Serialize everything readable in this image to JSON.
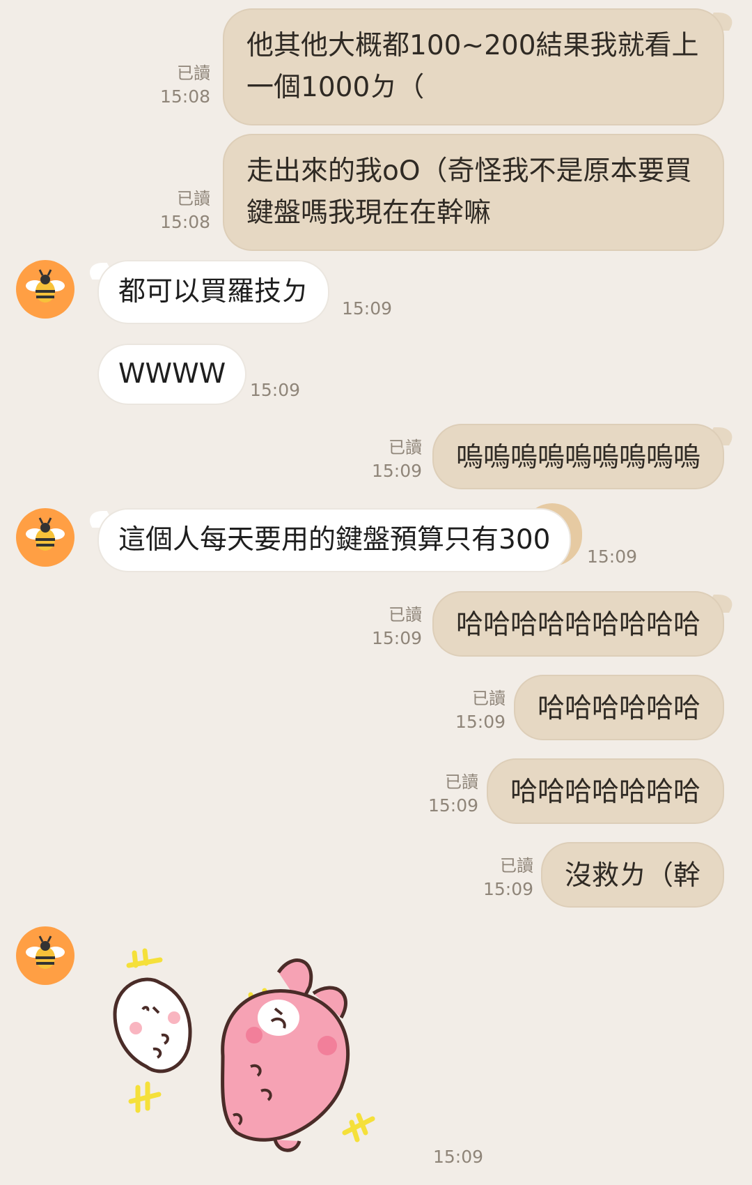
{
  "read_label": "已讀",
  "messages": [
    {
      "side": "out",
      "text": "他其他大概都100~200結果我就看上\n一個1000ㄉ（",
      "time": "15:08",
      "read": "已讀"
    },
    {
      "side": "out",
      "text": "走出來的我oO（奇怪我不是原本要買\n鍵盤嗎我現在在幹嘛",
      "time": "15:08",
      "read": "已讀"
    },
    {
      "side": "in",
      "text": "都可以買羅技ㄉ",
      "time": "15:09"
    },
    {
      "side": "in",
      "text": "WWWW",
      "time": "15:09"
    },
    {
      "side": "out",
      "text": "嗚嗚嗚嗚嗚嗚嗚嗚嗚",
      "time": "15:09",
      "read": "已讀"
    },
    {
      "side": "in",
      "text": "這個人每天要用的鍵盤預算只有300",
      "time": "15:09"
    },
    {
      "side": "out",
      "text": "哈哈哈哈哈哈哈哈哈",
      "time": "15:09",
      "read": "已讀"
    },
    {
      "side": "out",
      "text": "哈哈哈哈哈哈",
      "time": "15:09",
      "read": "已讀"
    },
    {
      "side": "out",
      "text": "哈哈哈哈哈哈哈",
      "time": "15:09",
      "read": "已讀"
    },
    {
      "side": "out",
      "text": "沒救ㄌ（幹",
      "time": "15:09",
      "read": "已讀"
    },
    {
      "side": "in",
      "type": "sticker",
      "sticker": "kanahei-piske-usagi-laughing",
      "time": "15:09"
    }
  ],
  "contact": {
    "avatar_icon": "bee-icon",
    "avatar_color": "#ff9f44"
  },
  "colors": {
    "background": "#f2ede7",
    "bubble_out": "#e6d8c3",
    "bubble_in": "#ffffff",
    "meta": "#8f8579"
  }
}
